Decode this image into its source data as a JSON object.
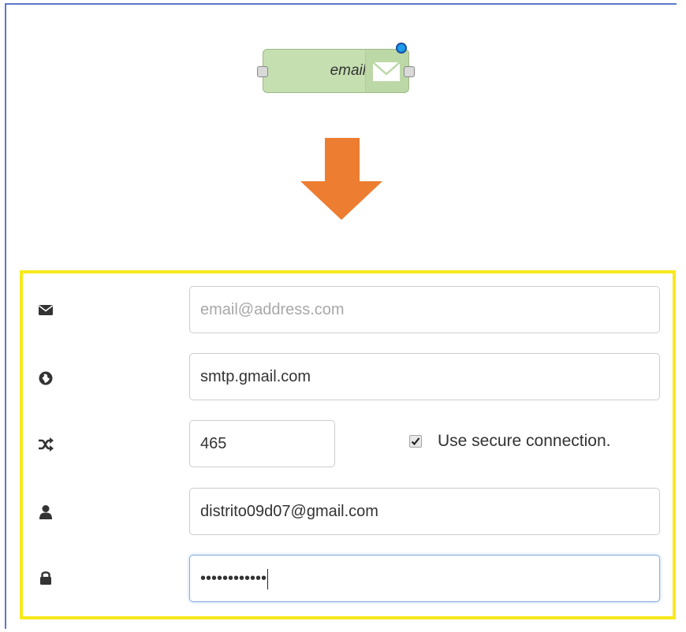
{
  "node": {
    "label": "email",
    "icon": "envelope-icon",
    "color": "#c5dfb0",
    "status_color": "#1c9cea"
  },
  "arrow": {
    "color": "#ed7d31"
  },
  "panel": {
    "border_color": "#f7e91a"
  },
  "form": {
    "to": {
      "icon": "envelope-icon",
      "value": "",
      "placeholder": "email@address.com"
    },
    "server": {
      "icon": "globe-icon",
      "value": "smtp.gmail.com"
    },
    "port": {
      "icon": "random-icon",
      "value": "465"
    },
    "secure": {
      "checked": true,
      "label": "Use secure connection."
    },
    "userid": {
      "icon": "user-icon",
      "value": "distrito09d07@gmail.com"
    },
    "password": {
      "icon": "lock-icon",
      "value": "••••••••••••"
    }
  }
}
